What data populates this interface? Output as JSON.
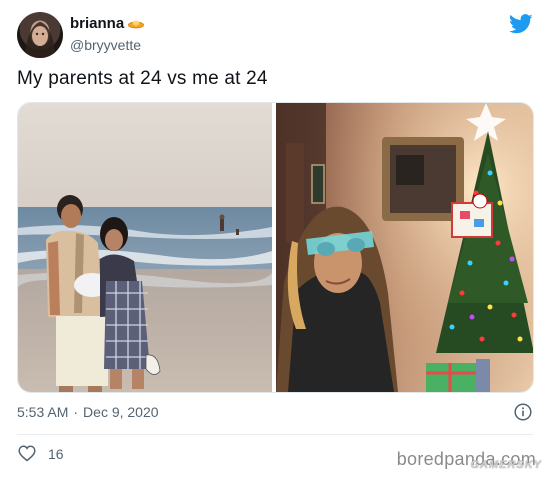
{
  "tweet": {
    "display_name": "brianna",
    "name_emoji": "ufo-emoji-icon",
    "handle": "@bryyvette",
    "text": "My parents at 24 vs me at 24",
    "time": "5:53 AM",
    "separator": "·",
    "date": "Dec 9, 2020",
    "like_count": "16"
  },
  "icons": {
    "brand": "twitter-bird-icon",
    "info": "info-icon",
    "like": "heart-outline-icon"
  },
  "watermark": {
    "text": "boredpanda.com",
    "secondary": "GAMERSKY"
  },
  "colors": {
    "twitter_blue": "#1d9bf0",
    "secondary_text": "#536471",
    "primary_text": "#0f1419"
  }
}
